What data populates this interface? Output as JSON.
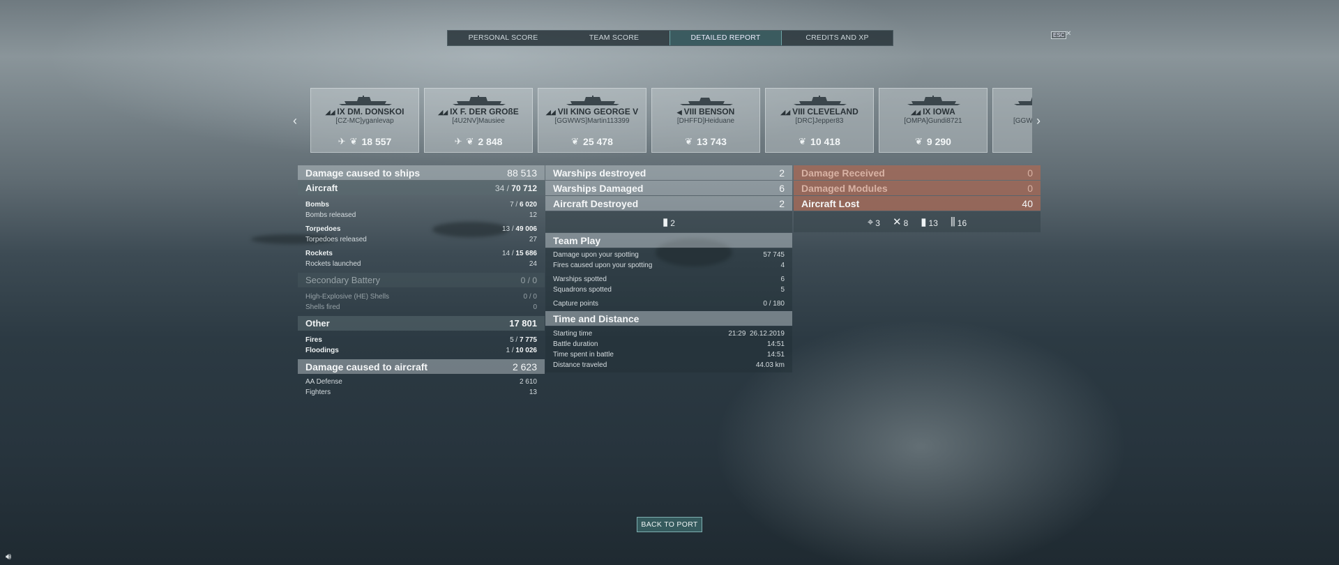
{
  "tabs": [
    {
      "label": "PERSONAL SCORE",
      "active": false
    },
    {
      "label": "TEAM SCORE",
      "active": false
    },
    {
      "label": "DETAILED REPORT",
      "active": true
    },
    {
      "label": "CREDITS AND XP",
      "active": false
    }
  ],
  "esc_label": "ESC",
  "ships": [
    {
      "name": "IX DM. DONSKOI",
      "player": "[CZ-MC]yganlevap",
      "score": "18 557",
      "type_icon": "cruiser-class-icon"
    },
    {
      "name": "IX F. DER GROßE",
      "player": "[4U2NV]Mausiee",
      "score": "2 848",
      "type_icon": "battleship-class-icon"
    },
    {
      "name": "VII KING GEORGE V",
      "player": "[GGWWS]Martin113399",
      "score": "25 478",
      "type_icon": "battleship-class-icon"
    },
    {
      "name": "VIII BENSON",
      "player": "[DHFFD]Heiduane",
      "score": "13 743",
      "type_icon": "destroyer-class-icon"
    },
    {
      "name": "VIII CLEVELAND",
      "player": "[DRC]Jepper83",
      "score": "10 418",
      "type_icon": "cruiser-class-icon"
    },
    {
      "name": "IX IOWA",
      "player": "[OMPA]Gundi8721",
      "score": "9 290",
      "type_icon": "battleship-class-icon"
    },
    {
      "name": "",
      "player": "[GGW",
      "score": "",
      "type_icon": "battleship-class-icon"
    }
  ],
  "left": {
    "damage_ships": {
      "label": "Damage caused to ships",
      "value": "88 513"
    },
    "aircraft": {
      "label": "Aircraft",
      "hits": "34",
      "value": "70 712"
    },
    "bombs": {
      "label": "Bombs",
      "hits": "7",
      "value": "6 020"
    },
    "bombs_released": {
      "label": "Bombs released",
      "value": "12"
    },
    "torpedoes": {
      "label": "Torpedoes",
      "hits": "13",
      "value": "49 006"
    },
    "torpedoes_released": {
      "label": "Torpedoes released",
      "value": "27"
    },
    "rockets": {
      "label": "Rockets",
      "hits": "14",
      "value": "15 686"
    },
    "rockets_launched": {
      "label": "Rockets launched",
      "value": "24"
    },
    "secondary": {
      "label": "Secondary Battery",
      "value": "0 / 0"
    },
    "he_shells": {
      "label": "High-Explosive (HE) Shells",
      "value": "0 / 0"
    },
    "shells_fired": {
      "label": "Shells fired",
      "value": "0"
    },
    "other": {
      "label": "Other",
      "value": "17 801"
    },
    "fires": {
      "label": "Fires",
      "hits": "5",
      "value": "7 775"
    },
    "floodings": {
      "label": "Floodings",
      "hits": "1",
      "value": "10 026"
    },
    "damage_aircraft": {
      "label": "Damage caused to aircraft",
      "value": "2 623"
    },
    "aa_defense": {
      "label": "AA Defense",
      "value": "2 610"
    },
    "fighters": {
      "label": "Fighters",
      "value": "13"
    }
  },
  "middle": {
    "warships_destroyed": {
      "label": "Warships destroyed",
      "value": "2"
    },
    "warships_damaged": {
      "label": "Warships Damaged",
      "value": "6"
    },
    "aircraft_destroyed": {
      "label": "Aircraft Destroyed",
      "value": "2"
    },
    "aircraft_icon_count": "2",
    "team_play": {
      "label": "Team Play"
    },
    "damage_spotting": {
      "label": "Damage upon your spotting",
      "value": "57 745"
    },
    "fires_spotting": {
      "label": "Fires caused upon your spotting",
      "value": "4"
    },
    "warships_spotted": {
      "label": "Warships spotted",
      "value": "6"
    },
    "squadrons_spotted": {
      "label": "Squadrons spotted",
      "value": "5"
    },
    "capture_points": {
      "label": "Capture points",
      "value": "0 / 180"
    },
    "time_distance": {
      "label": "Time and Distance"
    },
    "starting_time": {
      "label": "Starting time",
      "value": "21:29  26.12.2019"
    },
    "battle_duration": {
      "label": "Battle duration",
      "value": "14:51"
    },
    "time_in_battle": {
      "label": "Time spent in battle",
      "value": "14:51"
    },
    "distance": {
      "label": "Distance traveled",
      "value": "44.03 km"
    }
  },
  "right": {
    "damage_received": {
      "label": "Damage Received",
      "value": "0"
    },
    "damaged_modules": {
      "label": "Damaged Modules",
      "value": "0"
    },
    "aircraft_lost": {
      "label": "Aircraft Lost",
      "value": "40"
    },
    "icons": [
      {
        "icon": "crosshair-icon",
        "value": "3"
      },
      {
        "icon": "plane-shot-down-icon",
        "value": "8"
      },
      {
        "icon": "bomb-icon",
        "value": "13"
      },
      {
        "icon": "rockets-icon",
        "value": "16"
      }
    ]
  },
  "back_button": "BACK TO PORT"
}
